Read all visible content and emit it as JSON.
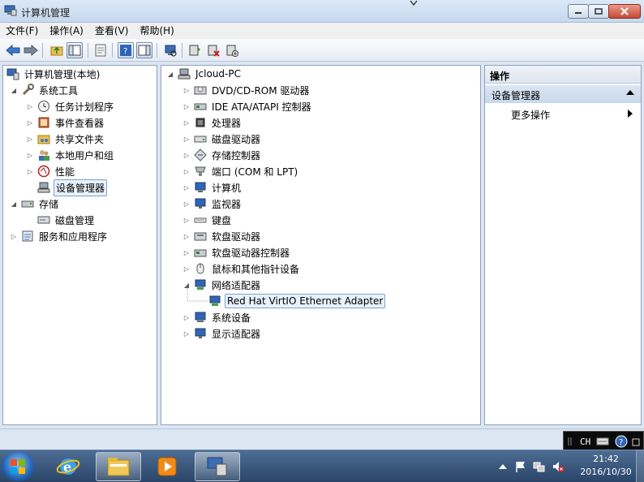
{
  "window": {
    "title": "计算机管理"
  },
  "menu": [
    {
      "id": "file",
      "label": "文件(F)"
    },
    {
      "id": "action",
      "label": "操作(A)"
    },
    {
      "id": "view",
      "label": "查看(V)"
    },
    {
      "id": "help",
      "label": "帮助(H)"
    }
  ],
  "left_tree": {
    "root": "计算机管理(本地)",
    "system_tools": "系统工具",
    "task_scheduler": "任务计划程序",
    "event_viewer": "事件查看器",
    "shared_folders": "共享文件夹",
    "local_users": "本地用户和组",
    "performance": "性能",
    "device_manager": "设备管理器",
    "storage": "存储",
    "disk_management": "磁盘管理",
    "services_apps": "服务和应用程序"
  },
  "devices": {
    "root": "Jcloud-PC",
    "dvd": "DVD/CD-ROM 驱动器",
    "ide": "IDE ATA/ATAPI 控制器",
    "cpu": "处理器",
    "disk": "磁盘驱动器",
    "storage_ctrl": "存储控制器",
    "ports": "端口 (COM 和 LPT)",
    "computer": "计算机",
    "monitor": "监视器",
    "keyboard": "键盘",
    "floppy": "软盘驱动器",
    "floppy_ctrl": "软盘驱动器控制器",
    "mouse": "鼠标和其他指针设备",
    "network": "网络适配器",
    "nic": "Red Hat VirtIO Ethernet Adapter",
    "system_devices": "系统设备",
    "display": "显示适配器"
  },
  "actions": {
    "header": "操作",
    "section": "设备管理器",
    "more": "更多操作"
  },
  "lang": {
    "code": "CH"
  },
  "clock": {
    "time": "21:42",
    "date": "2016/10/30"
  }
}
